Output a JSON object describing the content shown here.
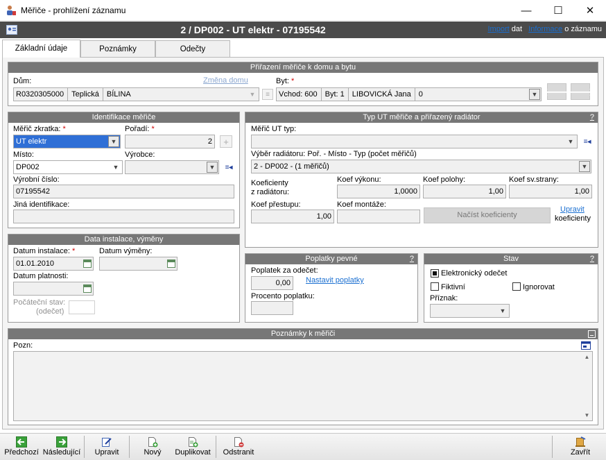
{
  "window": {
    "title": "Měřiče - prohlížení záznamu",
    "minimize": "—",
    "maximize": "☐",
    "close": "✕"
  },
  "header": {
    "title": "2 / DP002 - UT elektr - 07195542",
    "import_link": "Import",
    "import_suffix": "dat",
    "info_link": "Informace",
    "info_suffix": "o záznamu"
  },
  "tabs": [
    {
      "label": "Základní údaje",
      "active": true
    },
    {
      "label": "Poznámky",
      "active": false
    },
    {
      "label": "Odečty",
      "active": false
    }
  ],
  "assignment": {
    "title": "Přiřazení měřiče k domu a bytu",
    "house_label": "Dům:",
    "change_house": "Změna domu",
    "house_value": [
      "R0320305000",
      "Teplická",
      "BÍLINA"
    ],
    "flat_label": "Byt:",
    "required": "*",
    "flat_value": [
      "Vchod: 600",
      "Byt:  1",
      "LIBOVICKÁ Jana",
      "0"
    ],
    "prev_icon": "arrow-left-icon",
    "next_icon": "arrow-right-icon"
  },
  "identification": {
    "title": "Identifikace měřiče",
    "short_label": "Měřič zkratka:",
    "short_value": "UT elektr",
    "order_label": "Pořadí:",
    "order_value": "2",
    "plus": "+",
    "place_label": "Místo:",
    "place_value": "DP002",
    "maker_label": "Výrobce:",
    "maker_value": "",
    "serial_label": "Výrobní číslo:",
    "serial_value": "07195542",
    "other_label": "Jiná identifikace:",
    "other_value": ""
  },
  "install": {
    "title": "Data instalace, výměny",
    "date_install_label": "Datum instalace:",
    "date_install_value": "01.01.2010",
    "date_replace_label": "Datum výměny:",
    "date_replace_value": "",
    "validity_label": "Datum platnosti:",
    "validity_value": "",
    "initial_label_1": "Počáteční stav:",
    "initial_label_2": "(odečet)",
    "initial_value": ""
  },
  "type": {
    "title": "Typ UT měřiče a přiřazený radiátor",
    "help": "?",
    "meter_type_label": "Měřič UT typ:",
    "meter_type_value": "",
    "radiator_label": "Výběr radiátoru:  Poř. - Místo - Typ (počet měřičů)",
    "radiator_value": "2 - DP002 -  (1 měřičů)",
    "coef_label_1": "Koeficienty",
    "coef_label_2": "z radiátoru:",
    "power_label": "Koef výkonu:",
    "power_value": "1,0000",
    "position_label": "Koef polohy:",
    "position_value": "1,00",
    "side_label": "Koef sv.strany:",
    "side_value": "1,00",
    "transfer_label": "Koef přestupu:",
    "transfer_value": "1,00",
    "mount_label": "Koef montáže:",
    "mount_value": "",
    "load_button": "Načíst koeficienty",
    "edit_link": "Upravit",
    "edit_suffix": "koeficienty"
  },
  "fees": {
    "title": "Poplatky pevné",
    "help": "?",
    "fee_label": "Poplatek za odečet:",
    "fee_value": "0,00",
    "set_link": "Nastavit poplatky",
    "percent_label": "Procento poplatku:",
    "percent_value": ""
  },
  "state": {
    "title": "Stav",
    "help": "?",
    "electronic": {
      "label": "Elektronický odečet",
      "checked": true
    },
    "fictive": {
      "label": "Fiktivní",
      "checked": false
    },
    "ignore": {
      "label": "Ignorovat",
      "checked": false
    },
    "flag_label": "Příznak:",
    "flag_value": ""
  },
  "notes": {
    "title": "Poznámky k měřiči",
    "note_label": "Pozn:",
    "note_value": ""
  },
  "toolbar": {
    "prev": "Předchozí",
    "next": "Následující",
    "edit": "Upravit",
    "new": "Nový",
    "duplicate": "Duplikovat",
    "remove": "Odstranit",
    "close": "Zavřít"
  },
  "colors": {
    "header_bg": "#4b4b4b",
    "group_title_bg": "#777777",
    "link": "#1a6fd1",
    "required": "#d00000",
    "selection": "#2f6fd6"
  }
}
